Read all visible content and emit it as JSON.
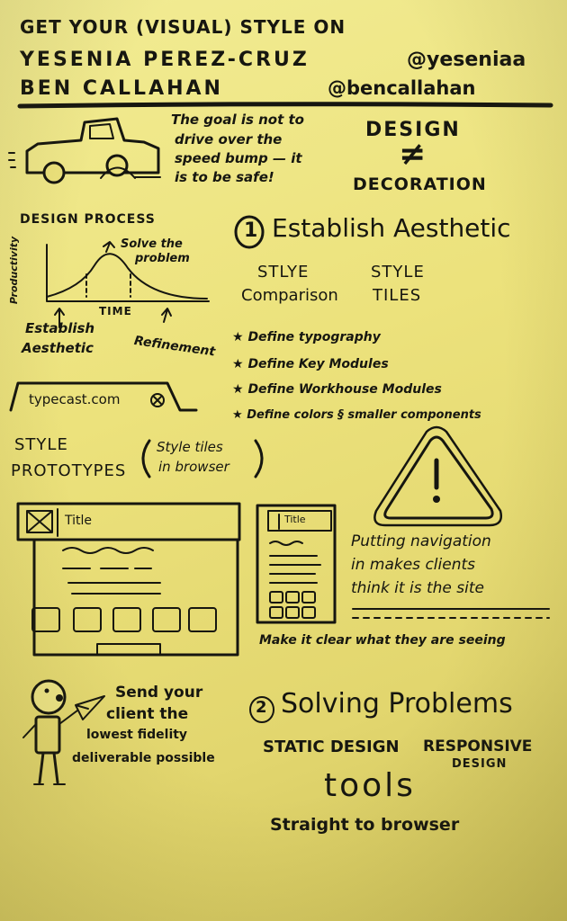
{
  "header": {
    "title": "GET YOUR (VISUAL) STYLE ON",
    "speaker1_name": "YESENIA PEREZ-CRUZ",
    "speaker1_handle": "@yeseniaa",
    "speaker2_name": "BEN CALLAHAN",
    "speaker2_handle": "@bencallahan"
  },
  "intro": {
    "quote_line1": "The goal is not to",
    "quote_line2": "drive over the",
    "quote_line3": "speed bump — it",
    "quote_line4": "is to be safe!",
    "design_word": "DESIGN",
    "not_equal": "≠",
    "decoration_word": "DECORATION"
  },
  "design_process": {
    "title": "DESIGN PROCESS",
    "solve_label_1": "Solve the",
    "solve_label_2": "problem",
    "y_axis": "Productivity",
    "x_axis": "TIME",
    "establish_1": "Establish",
    "establish_2": "Aesthetic",
    "refinement": "Refinement"
  },
  "section1": {
    "number": "1",
    "heading": "Establish Aesthetic",
    "style_comparison_1": "STLYE",
    "style_comparison_2": "Comparison",
    "style_tiles_1": "STYLE",
    "style_tiles_2": "TILES",
    "bullets": [
      "Define typography",
      "Define Key Modules",
      "Define Workhouse Modules",
      "Define colors § smaller components"
    ],
    "url_bar_text": "typecast.com"
  },
  "prototypes": {
    "title_1": "STYLE",
    "title_2": "PROTOTYPES",
    "aside_1": "Style tiles",
    "aside_2": "in browser",
    "wire_title_large": "Title",
    "wire_title_small": "Title"
  },
  "warning": {
    "line1": "Putting navigation",
    "line2": "in makes clients",
    "line3": "think it is the site",
    "footer": "Make it clear what they are seeing"
  },
  "client": {
    "line1": "Send your",
    "line2": "client the",
    "line3": "lowest fidelity",
    "line4": "deliverable possible"
  },
  "section2": {
    "number": "2",
    "heading": "Solving Problems",
    "static_design": "STATIC DESIGN",
    "responsive_1": "RESPONSIVE",
    "responsive_2": "DESIGN",
    "tools": "tools",
    "straight": "Straight to browser"
  }
}
